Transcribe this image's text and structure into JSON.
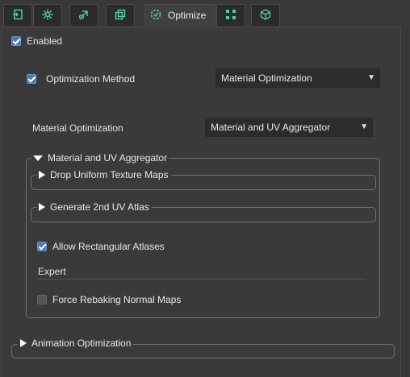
{
  "tabs": [
    {
      "icon": "import-icon"
    },
    {
      "icon": "gear-icon"
    },
    {
      "icon": "link-icon"
    },
    {
      "icon": "layers-icon"
    },
    {
      "icon": "optimize-icon",
      "label": "Optimize"
    },
    {
      "icon": "nodes-icon"
    },
    {
      "icon": "cube-icon"
    }
  ],
  "enabled": {
    "label": "Enabled",
    "checked": true
  },
  "optimization_method": {
    "label": "Optimization Method",
    "checked": true,
    "value": "Material Optimization"
  },
  "material_optimization": {
    "label": "Material Optimization",
    "value": "Material and UV Aggregator"
  },
  "aggregator_group": {
    "title": "Material and UV Aggregator",
    "drop_uniform": "Drop Uniform Texture Maps",
    "generate_atlas": "Generate 2nd UV Atlas",
    "allow_rect": {
      "label": "Allow Rectangular Atlases",
      "checked": true
    },
    "expert": "Expert",
    "force_rebake": {
      "label": "Force Rebaking Normal Maps",
      "checked": false
    }
  },
  "animation_group": {
    "title": "Animation Optimization"
  },
  "colors": {
    "accent": "#4d7dbd",
    "icon": "#4ecf9a"
  }
}
